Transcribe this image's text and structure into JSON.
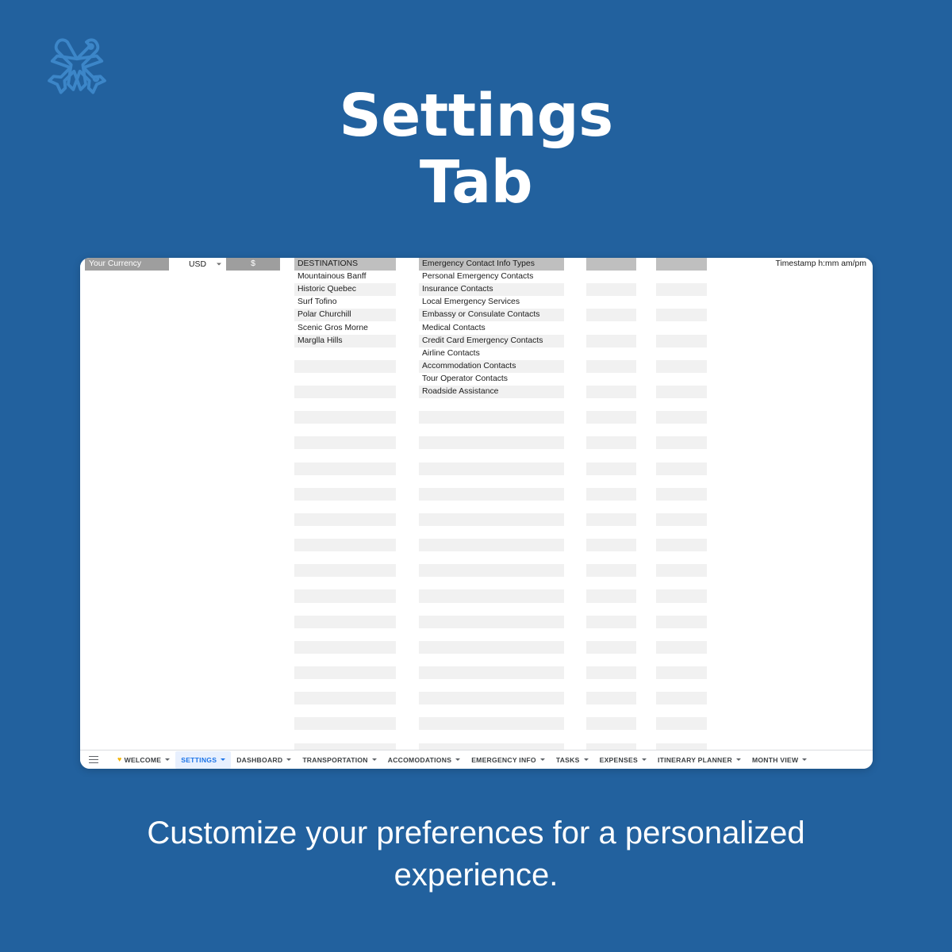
{
  "page": {
    "background_color": "#22619E",
    "title_line1": "Settings",
    "title_line2": "Tab",
    "caption": "Customize your preferences for a personalized experience.",
    "logo_icon": "crossed-airplanes-icon",
    "logo_color": "#3C86C8"
  },
  "spreadsheet": {
    "currency": {
      "label": "Your Currency",
      "selected": "USD",
      "symbol": "$",
      "caret_icon": "chevron-down-icon"
    },
    "timestamp": "Timestamp h:mm am/pm",
    "columns": [
      {
        "key": "destinations",
        "header": "DESTINATIONS",
        "values": [
          "Mountainous Banff",
          "Historic Quebec",
          "Surf Tofino",
          "Polar Churchill",
          "Scenic Gros Morne",
          "Marglla Hills"
        ]
      },
      {
        "key": "emergency_contact_info_types",
        "header": "Emergency Contact Info Types",
        "values": [
          "Personal Emergency Contacts",
          "Insurance Contacts",
          "Local Emergency Services",
          "Embassy or Consulate Contacts",
          "Medical Contacts",
          "Credit Card Emergency Contacts",
          "Airline Contacts",
          "Accommodation Contacts",
          "Tour Operator Contacts",
          "Roadside Assistance"
        ]
      },
      {
        "key": "column_3",
        "header": "",
        "values": []
      },
      {
        "key": "column_4",
        "header": "",
        "values": []
      }
    ],
    "colors": {
      "header_fill": "#BFBFBF",
      "stripe_fill": "#F1F1F1",
      "label_fill": "#9E9E9E"
    }
  },
  "tabbar": {
    "menu_icon": "hamburger-menu-icon",
    "active_tab": "SETTINGS",
    "active_color": "#1A73E8",
    "tabs": [
      {
        "label": "WELCOME",
        "icon": "heart-icon",
        "active": false
      },
      {
        "label": "SETTINGS",
        "icon": "",
        "active": true
      },
      {
        "label": "DASHBOARD",
        "icon": "",
        "active": false
      },
      {
        "label": "TRANSPORTATION",
        "icon": "",
        "active": false
      },
      {
        "label": "ACCOMODATIONS",
        "icon": "",
        "active": false
      },
      {
        "label": "EMERGENCY INFO",
        "icon": "",
        "active": false
      },
      {
        "label": "TASKS",
        "icon": "",
        "active": false
      },
      {
        "label": "EXPENSES",
        "icon": "",
        "active": false
      },
      {
        "label": "ITINERARY PLANNER",
        "icon": "",
        "active": false
      },
      {
        "label": "MONTH VIEW",
        "icon": "",
        "active": false
      }
    ]
  }
}
